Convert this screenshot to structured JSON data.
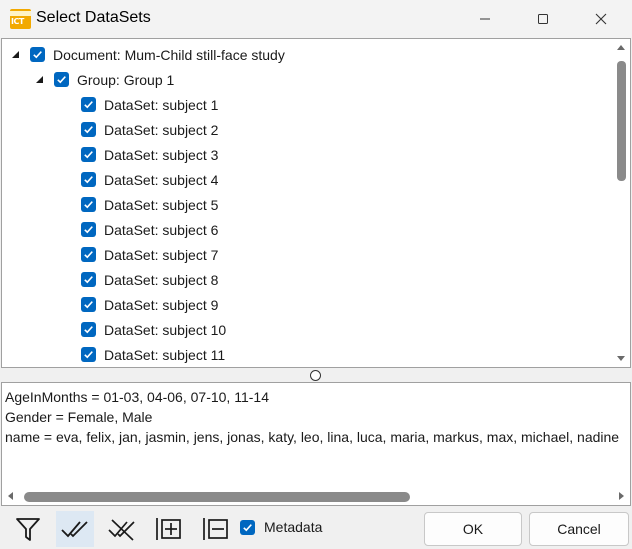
{
  "window": {
    "title": "Select DataSets",
    "app_icon_text": "ICT"
  },
  "tree": {
    "document": {
      "label": "Document: Mum-Child still-face study",
      "checked": true,
      "expanded": true
    },
    "group": {
      "label": "Group: Group 1",
      "checked": true,
      "expanded": true
    },
    "datasets": [
      "DataSet: subject 1",
      "DataSet: subject 2",
      "DataSet: subject 3",
      "DataSet: subject 4",
      "DataSet: subject 5",
      "DataSet: subject 6",
      "DataSet: subject 7",
      "DataSet: subject 8",
      "DataSet: subject 9",
      "DataSet: subject 10",
      "DataSet: subject 11"
    ]
  },
  "metadata_panel": {
    "lines": [
      "AgeInMonths = 01-03, 04-06, 07-10, 11-14",
      "Gender = Female, Male",
      "name = eva, felix, jan, jasmin, jens, jonas, katy, leo, lina, luca, maria, markus, max, michael, nadine"
    ]
  },
  "toolbar": {
    "metadata_label": "Metadata",
    "metadata_checked": true,
    "ok_label": "OK",
    "cancel_label": "Cancel"
  },
  "colors": {
    "checkbox_accent": "#0067c0",
    "active_tool_bg": "#dde8f3"
  }
}
